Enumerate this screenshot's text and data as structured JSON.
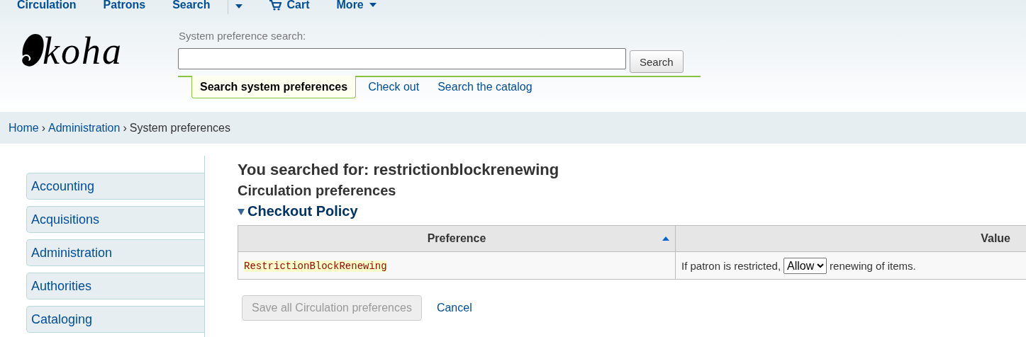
{
  "top_nav": [
    {
      "label": "Circulation",
      "kind": "link"
    },
    {
      "label": "Patrons",
      "kind": "link"
    },
    {
      "label": "Search",
      "kind": "link"
    },
    {
      "kind": "caret"
    },
    {
      "label": "Cart",
      "kind": "cart"
    },
    {
      "label": "More",
      "kind": "menu"
    }
  ],
  "logo": {
    "text": "koha"
  },
  "search": {
    "label": "System preference search:",
    "button": "Search"
  },
  "search_tabs": [
    {
      "label": "Search system preferences",
      "selected": true
    },
    {
      "label": "Check out",
      "selected": false
    },
    {
      "label": "Search the catalog",
      "selected": false
    }
  ],
  "breadcrumb_separator": "›",
  "breadcrumbs": [
    {
      "label": "Home",
      "link": true
    },
    {
      "label": "Administration",
      "link": true
    },
    {
      "label": "System preferences",
      "link": false
    }
  ],
  "sidebar": {
    "items": [
      {
        "label": "Accounting"
      },
      {
        "label": "Acquisitions"
      },
      {
        "label": "Administration"
      },
      {
        "label": "Authorities"
      },
      {
        "label": "Cataloging"
      }
    ]
  },
  "main": {
    "title": "You searched for: restrictionblockrenewing",
    "section": "Circulation preferences",
    "group": {
      "title": "Checkout Policy",
      "expanded": true
    },
    "table": {
      "columns": [
        {
          "label": "Preference",
          "sorted": true
        },
        {
          "label": "Value",
          "sorted": false
        }
      ],
      "rows": [
        {
          "preference": "RestrictionBlockRenewing",
          "before": "If patron is restricted,",
          "select": "Allow",
          "after": "renewing of items."
        }
      ]
    },
    "save_button": {
      "label": "Save all Circulation preferences",
      "disabled": true
    },
    "cancel": "Cancel"
  }
}
